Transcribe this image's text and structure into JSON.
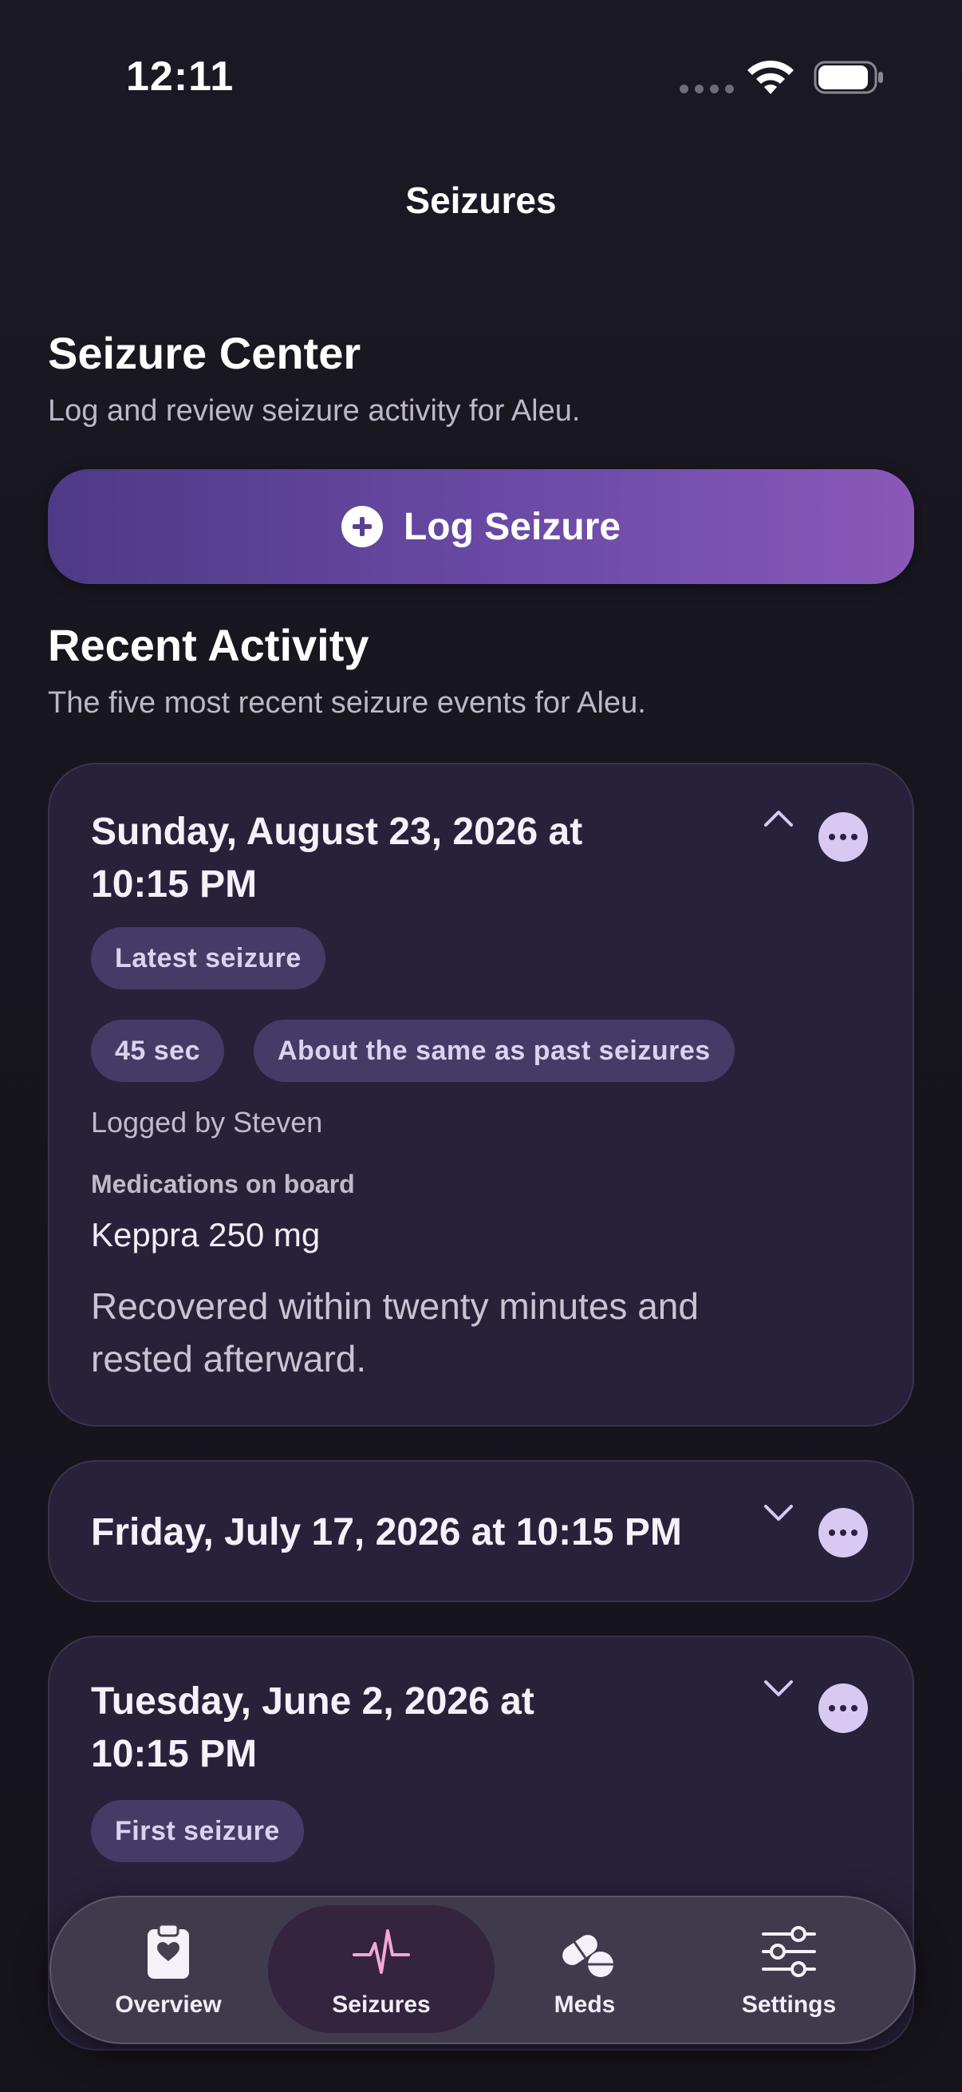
{
  "status_bar": {
    "time": "12:11"
  },
  "nav": {
    "title": "Seizures"
  },
  "seizure_center": {
    "title": "Seizure Center",
    "subtitle": "Log and review seizure activity for Aleu.",
    "log_button_label": "Log Seizure"
  },
  "recent_activity": {
    "title": "Recent Activity",
    "subtitle": "The five most recent seizure events for Aleu."
  },
  "events": [
    {
      "date": "Sunday, August 23, 2026 at 10:15 PM",
      "date_line1": "Sunday, August 23, 2026 at",
      "date_line2": "10:15 PM",
      "expanded": true,
      "badge": "Latest seizure",
      "duration": "45 sec",
      "comparison": "About the same as past seizures",
      "logged_by": "Logged by Steven",
      "meds_label": "Medications on board",
      "meds": "Keppra 250 mg",
      "notes": "Recovered within twenty minutes and rested afterward."
    },
    {
      "date": "Friday, July 17, 2026 at 10:15 PM",
      "expanded": false
    },
    {
      "date_line1": "Tuesday, June 2, 2026 at",
      "date_line2": "10:15 PM",
      "expanded": false,
      "badge": "First seizure"
    }
  ],
  "tab_bar": {
    "active": "Seizures",
    "tabs": [
      {
        "label": "Overview",
        "icon": "clipboard-heart-icon"
      },
      {
        "label": "Seizures",
        "icon": "waveform-icon"
      },
      {
        "label": "Meds",
        "icon": "pills-icon"
      },
      {
        "label": "Settings",
        "icon": "sliders-icon"
      }
    ]
  },
  "colors": {
    "background": "#1a1822",
    "card": "#27223a",
    "pill": "#463b66",
    "accent_start": "#4d3a86",
    "accent_end": "#8a58b8",
    "more_button": "#d8c9f3"
  }
}
